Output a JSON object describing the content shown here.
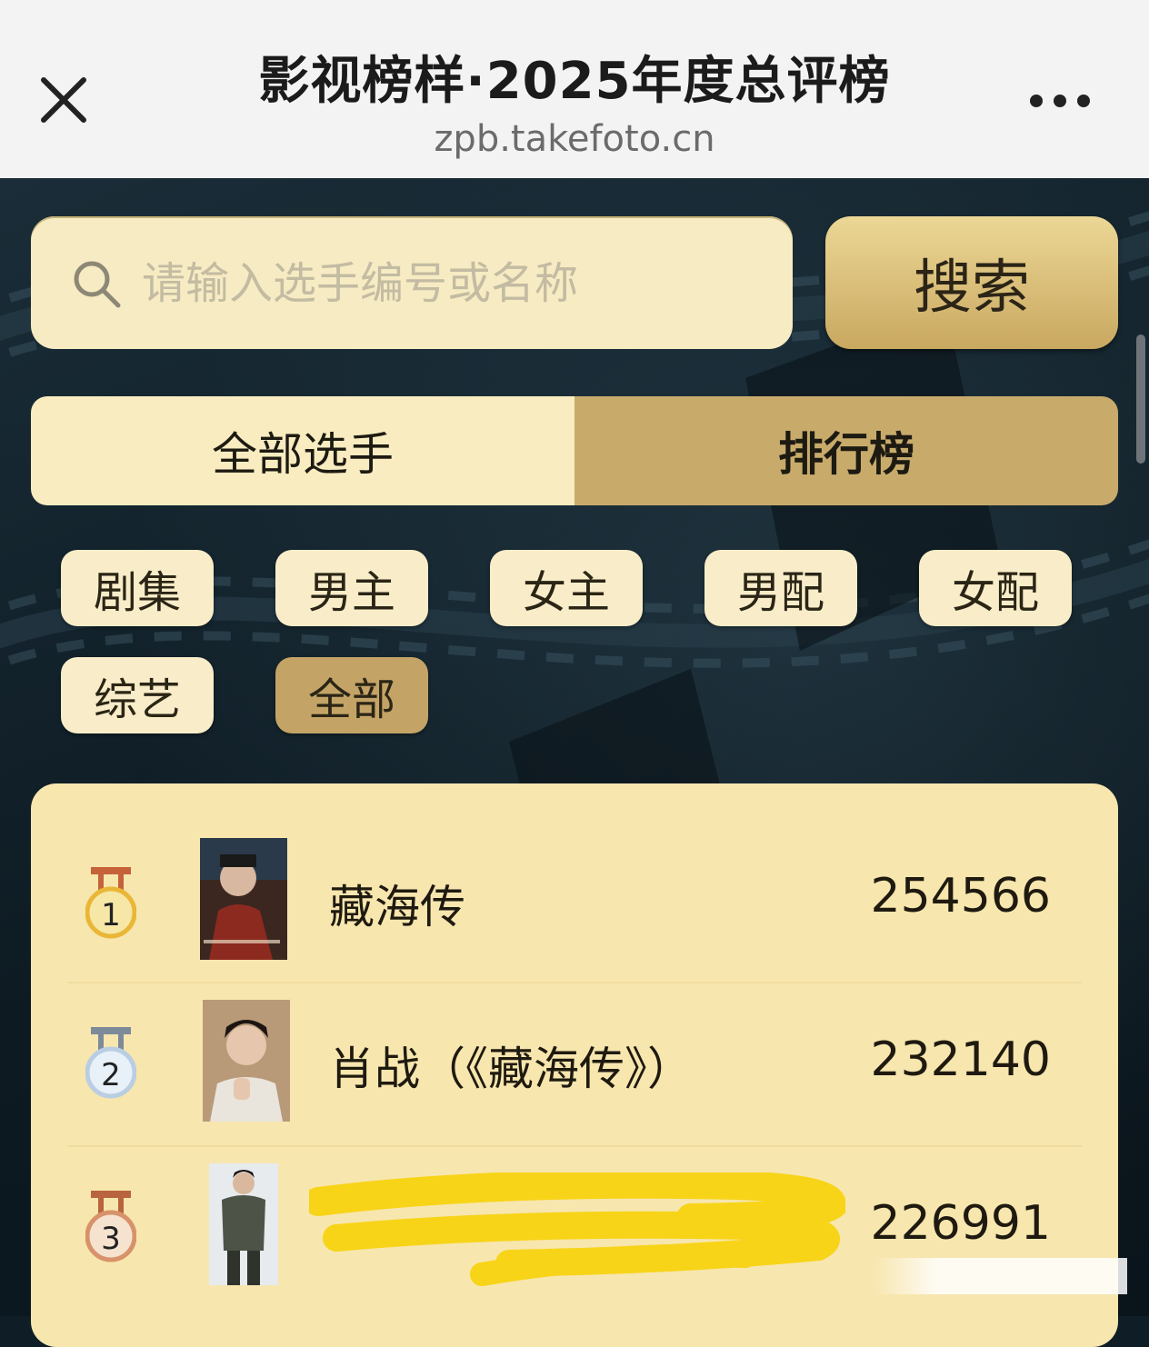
{
  "browser": {
    "title": "影视榜样·2025年度总评榜",
    "url": "zpb.takefoto.cn",
    "close_icon": "close-icon",
    "more_icon": "more-icon"
  },
  "search": {
    "placeholder": "请输入选手编号或名称",
    "value": "",
    "button_label": "搜索",
    "icon": "search-icon"
  },
  "tabs": [
    {
      "label": "全部选手",
      "active": false
    },
    {
      "label": "排行榜",
      "active": true
    }
  ],
  "categories": [
    {
      "label": "剧集",
      "active": false
    },
    {
      "label": "男主",
      "active": false
    },
    {
      "label": "女主",
      "active": false
    },
    {
      "label": "男配",
      "active": false
    },
    {
      "label": "女配",
      "active": false
    },
    {
      "label": "综艺",
      "active": false
    },
    {
      "label": "全部",
      "active": true
    }
  ],
  "ranking": [
    {
      "rank": "1",
      "name": "藏海传",
      "score": "254566",
      "medal_color": "#e9b637"
    },
    {
      "rank": "2",
      "name": "肖战（《藏海传》）",
      "score": "232140",
      "medal_color": "#b9cde3"
    },
    {
      "rank": "3",
      "name": "",
      "score": "226991",
      "medal_color": "#d8926a"
    }
  ],
  "colors": {
    "accent_gold": "#c8ab6b",
    "panel": "#f7e6ae",
    "highlight_scribble": "#f7d418"
  }
}
